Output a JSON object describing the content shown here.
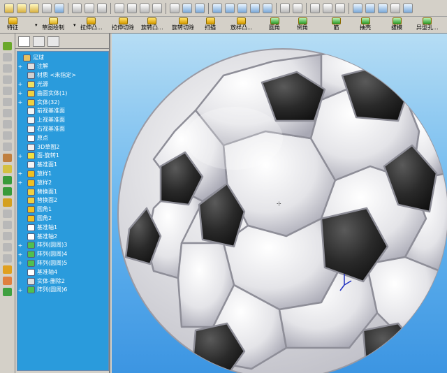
{
  "top_toolbar": {
    "icons": [
      "new-file-icon",
      "open-file-icon",
      "save-icon",
      "print-icon",
      "print-preview-icon",
      "cut-icon",
      "undo-icon",
      "redo-icon",
      "select-icon",
      "sketch-icon",
      "rebuild-icon",
      "options-icon",
      "grid-icon",
      "view-icon",
      "zoom-fit-icon",
      "zoom-area-icon",
      "zoom-in-icon",
      "rotate-icon",
      "pan-icon",
      "section-view-icon",
      "help-icon",
      "appearance-icon",
      "shaded-icon",
      "wireframe-icon",
      "perspective-icon",
      "front-view-icon",
      "iso-view-icon",
      "top-view-icon",
      "display-style-icon",
      "view-orientation-icon"
    ]
  },
  "command_bar": {
    "buttons": [
      {
        "label": "特征",
        "icon": "features-icon"
      },
      {
        "label": "草图绘制",
        "icon": "sketch-draw-icon"
      },
      {
        "label": "拉伸凸...",
        "icon": "extrude-boss-icon"
      },
      {
        "label": "拉伸切除",
        "icon": "extrude-cut-icon"
      },
      {
        "label": "旋转凸...",
        "icon": "revolve-boss-icon"
      },
      {
        "label": "旋转切除",
        "icon": "revolve-cut-icon"
      },
      {
        "label": "扫描",
        "icon": "sweep-icon"
      },
      {
        "label": "放样凸...",
        "icon": "loft-icon"
      },
      {
        "label": "圆角",
        "icon": "fillet-icon"
      },
      {
        "label": "倒角",
        "icon": "chamfer-icon"
      },
      {
        "label": "筋",
        "icon": "rib-icon"
      },
      {
        "label": "抽壳",
        "icon": "shell-icon"
      },
      {
        "label": "拔模",
        "icon": "draft-icon"
      },
      {
        "label": "异型孔...",
        "icon": "hole-wizard-icon"
      }
    ]
  },
  "feature_tree": {
    "tabs": [
      "feature-manager-tab",
      "property-manager-tab",
      "configuration-manager-tab"
    ],
    "items": [
      {
        "label": "足球",
        "icon": "part-icon",
        "expand": "",
        "indent": 0
      },
      {
        "label": "注解",
        "icon": "annotations-icon",
        "expand": "+",
        "indent": 1
      },
      {
        "label": "材质 <未指定>",
        "icon": "material-icon",
        "expand": "",
        "indent": 1
      },
      {
        "label": "光源",
        "icon": "lights-icon",
        "expand": "+",
        "indent": 1
      },
      {
        "label": "曲面实体(1)",
        "icon": "surface-bodies-icon",
        "expand": "+",
        "indent": 1
      },
      {
        "label": "实体(32)",
        "icon": "solid-bodies-icon",
        "expand": "+",
        "indent": 1
      },
      {
        "label": "前视基准面",
        "icon": "plane-icon",
        "expand": "",
        "indent": 1
      },
      {
        "label": "上视基准面",
        "icon": "plane-icon",
        "expand": "",
        "indent": 1
      },
      {
        "label": "右视基准面",
        "icon": "plane-icon",
        "expand": "",
        "indent": 1
      },
      {
        "label": "原点",
        "icon": "origin-icon",
        "expand": "",
        "indent": 1
      },
      {
        "label": "3D草图2",
        "icon": "3d-sketch-icon",
        "expand": "",
        "indent": 1
      },
      {
        "label": "面-旋转1",
        "icon": "revolve-surface-icon",
        "expand": "+",
        "indent": 1
      },
      {
        "label": "基准面1",
        "icon": "plane-icon",
        "expand": "",
        "indent": 1
      },
      {
        "label": "放样1",
        "icon": "loft-feature-icon",
        "expand": "+",
        "indent": 1
      },
      {
        "label": "放样2",
        "icon": "loft-feature-icon",
        "expand": "+",
        "indent": 1
      },
      {
        "label": "替换面1",
        "icon": "replace-face-icon",
        "expand": "",
        "indent": 1
      },
      {
        "label": "替换面2",
        "icon": "replace-face-icon",
        "expand": "",
        "indent": 1
      },
      {
        "label": "圆角1",
        "icon": "fillet-feature-icon",
        "expand": "",
        "indent": 1
      },
      {
        "label": "圆角2",
        "icon": "fillet-feature-icon",
        "expand": "",
        "indent": 1
      },
      {
        "label": "基准轴1",
        "icon": "axis-icon",
        "expand": "",
        "indent": 1
      },
      {
        "label": "基准轴2",
        "icon": "axis-icon",
        "expand": "",
        "indent": 1
      },
      {
        "label": "阵列(圆周)3",
        "icon": "circular-pattern-icon",
        "expand": "+",
        "indent": 1
      },
      {
        "label": "阵列(圆周)4",
        "icon": "circular-pattern-icon",
        "expand": "+",
        "indent": 1
      },
      {
        "label": "阵列(圆周)5",
        "icon": "circular-pattern-icon",
        "expand": "+",
        "indent": 1
      },
      {
        "label": "基准轴4",
        "icon": "axis-icon",
        "expand": "",
        "indent": 1
      },
      {
        "label": "实体-删除2",
        "icon": "delete-body-icon",
        "expand": "",
        "indent": 1
      },
      {
        "label": "阵列(圆周)6",
        "icon": "circular-pattern-icon",
        "expand": "+",
        "indent": 1
      }
    ]
  },
  "graphics_area": {
    "model": "soccer-ball-model",
    "triad": "coordinate-triad-icon",
    "colors": {
      "background_top": "#b6ddf4",
      "background_bottom": "#3c95e2",
      "white_panel": "#f2f2f4",
      "black_panel": "#2a2a2a"
    }
  }
}
